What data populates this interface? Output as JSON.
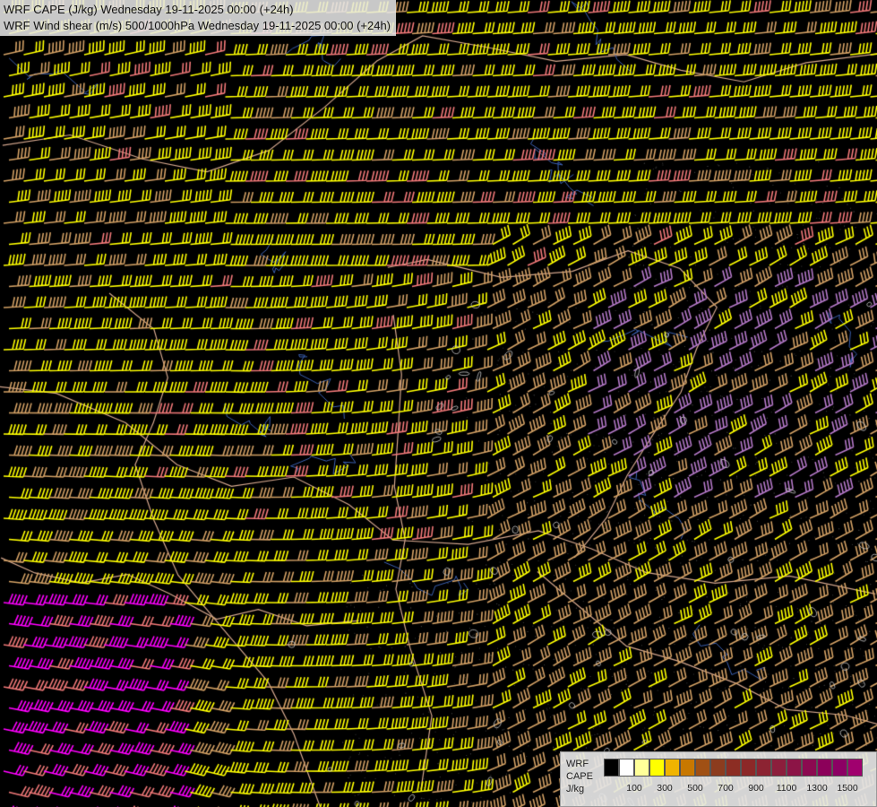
{
  "header": {
    "line1": "WRF CAPE (J/kg) Wednesday 19-11-2025 00:00 (+24h)",
    "line2": "WRF Wind shear (m/s) 500/1000hPa Wednesday 19-11-2025 00:00 (+24h)"
  },
  "legend": {
    "label_model": "WRF",
    "label_field": "CAPE",
    "label_unit": "J/kg",
    "swatch_colors": [
      "#000000",
      "#ffffff",
      "#ffff99",
      "#ffff00",
      "#f0b400",
      "#c87800",
      "#a05014",
      "#8c3c1e",
      "#8c2d23",
      "#8c2828",
      "#8c2332",
      "#8c1e3c",
      "#8c1446",
      "#8c0a50",
      "#8c005a",
      "#8c0064",
      "#a0006e"
    ],
    "ticks": [
      {
        "label": "100",
        "index": 2
      },
      {
        "label": "300",
        "index": 4
      },
      {
        "label": "500",
        "index": 6
      },
      {
        "label": "700",
        "index": 8
      },
      {
        "label": "900",
        "index": 10
      },
      {
        "label": "1100",
        "index": 12
      },
      {
        "label": "1300",
        "index": 14
      },
      {
        "label": "1500",
        "index": 16
      }
    ]
  },
  "map": {
    "background_color": "#000000",
    "border_color": "#d2a58c",
    "river_color": "#3a5fb0",
    "barb_colors": {
      "yellow": "#ffff00",
      "tan": "#d2a064",
      "salmon": "#f07878",
      "mauve": "#b478c8",
      "magenta": "#ff00ff"
    }
  }
}
